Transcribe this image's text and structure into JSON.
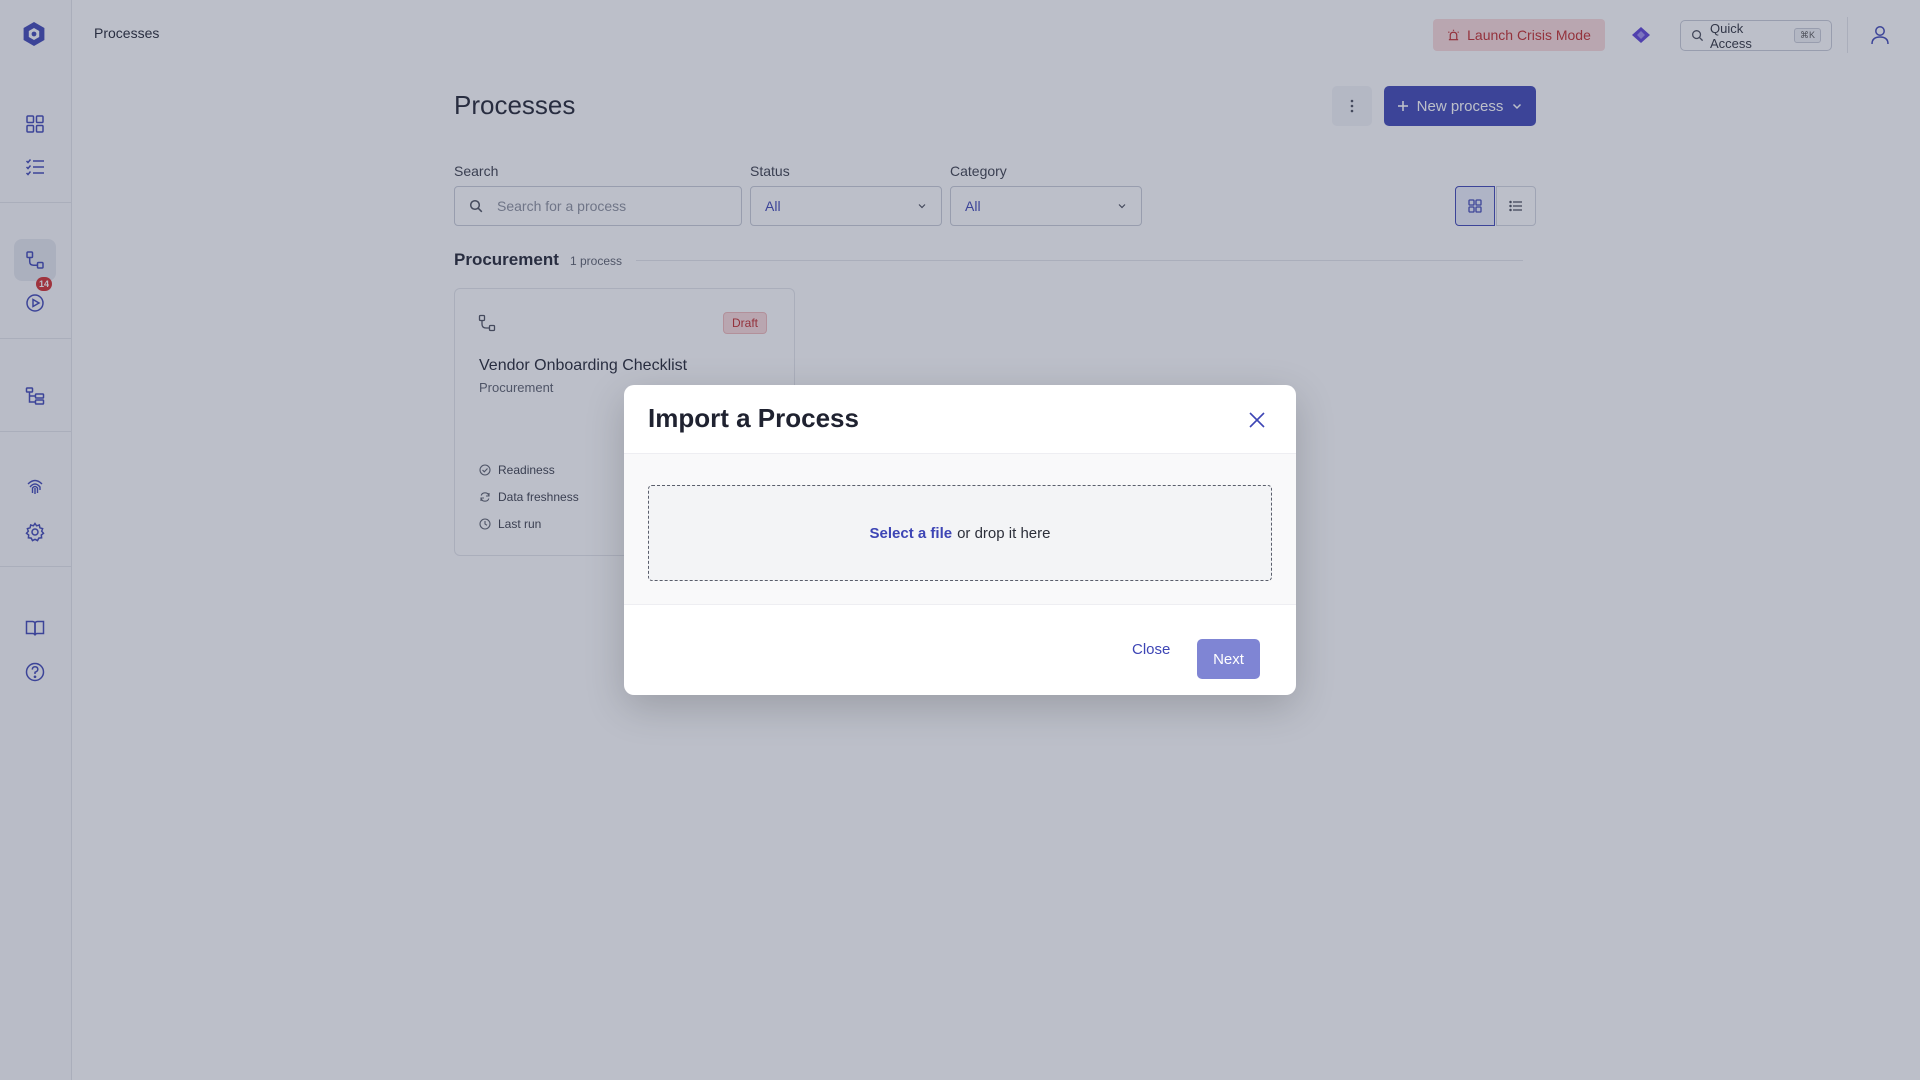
{
  "topbar": {
    "breadcrumb": "Processes",
    "crisis_label": "Launch Crisis Mode",
    "quick_access_label": "Quick Access",
    "quick_access_shortcut": "⌘K"
  },
  "sidebar": {
    "badge_count": "14",
    "icons": [
      "dashboard-icon",
      "checklist-icon",
      "processes-icon",
      "runs-icon",
      "hierarchy-icon",
      "fingerprint-icon",
      "gear-icon",
      "book-icon",
      "help-icon"
    ]
  },
  "page": {
    "title": "Processes",
    "new_process_label": "New process",
    "filters": {
      "search_label": "Search",
      "search_placeholder": "Search for a process",
      "status_label": "Status",
      "status_value": "All",
      "category_label": "Category",
      "category_value": "All"
    },
    "group": {
      "title": "Procurement",
      "count": "1 process"
    },
    "card": {
      "badge": "Draft",
      "title": "Vendor Onboarding Checklist",
      "category": "Procurement",
      "meta": [
        "Readiness",
        "Data freshness",
        "Last run"
      ]
    }
  },
  "modal": {
    "title": "Import a Process",
    "select_link": "Select a file",
    "drop_text": "or drop it here",
    "close_label": "Close",
    "next_label": "Next"
  },
  "colors": {
    "accent": "#3d45b5",
    "crisis_bg": "#fbdada",
    "crisis_text": "#c22a2a"
  }
}
